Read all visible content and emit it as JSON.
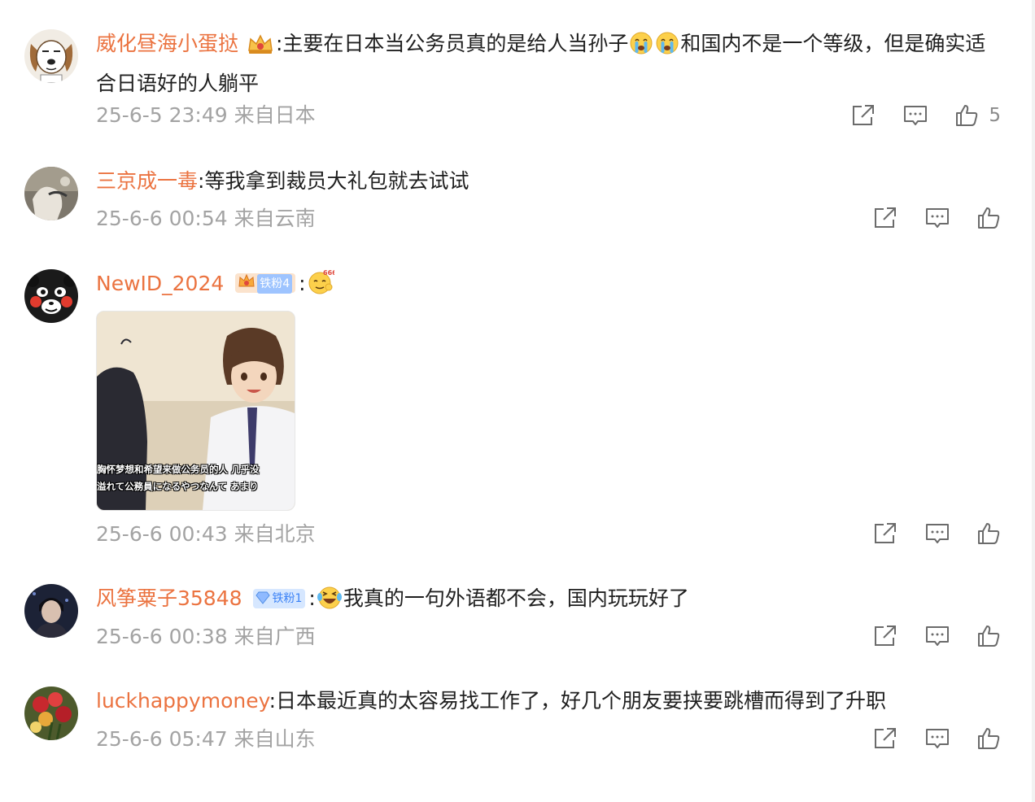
{
  "comments": [
    {
      "username": "威化昼海小蛋挞",
      "text_part1": ":主要在日本当公务员真的是给人当孙子",
      "text_part2": "和国内不是一个等级，但是确实适合日语好的人躺平",
      "time": "25-6-5 23:49",
      "location": "来自日本",
      "likes": "5",
      "avatar_icon": "dog-avatar",
      "badge_icon": "crown-badge-icon",
      "emojis": [
        "crying-emoji",
        "crying-emoji"
      ]
    },
    {
      "username": "三京成一毒",
      "text": ":等我拿到裁员大礼包就去试试",
      "time": "25-6-6 00:54",
      "location": "来自云南",
      "likes": "",
      "avatar_icon": "photo-avatar"
    },
    {
      "username": "NewID_2024",
      "badge_label": "铁粉4",
      "text": ":",
      "time": "25-6-6 00:43",
      "location": "来自北京",
      "likes": "",
      "avatar_icon": "kumamon-avatar",
      "emojis": [
        "666-emoji"
      ],
      "image": {
        "caption_cn": "胸怀梦想和希望来做公务员的人 几乎没",
        "caption_jp": "溢れて公務員になるやつなんて あまり"
      }
    },
    {
      "username": "风筝粟子35848",
      "badge_label": "铁粉1",
      "text": ":",
      "text_after": "我真的一句外语都不会，国内玩玩好了",
      "time": "25-6-6 00:38",
      "location": "来自广西",
      "likes": "",
      "avatar_icon": "portrait-avatar",
      "emojis": [
        "laughing-tears-emoji"
      ]
    },
    {
      "username": "luckhappymoney",
      "text": ":日本最近真的太容易找工作了，好几个朋友要挟要跳槽而得到了升职",
      "time": "25-6-6 05:47",
      "location": "来自山东",
      "likes": "",
      "avatar_icon": "flowers-avatar"
    }
  ],
  "action_icons": [
    "share-icon",
    "comment-icon",
    "like-icon"
  ],
  "colors": {
    "username": "#eb7340",
    "meta": "#a3a3a3",
    "badge_bg": "#d6e7ff",
    "badge_text": "#3b82f6",
    "icon": "#6b6b6b"
  }
}
